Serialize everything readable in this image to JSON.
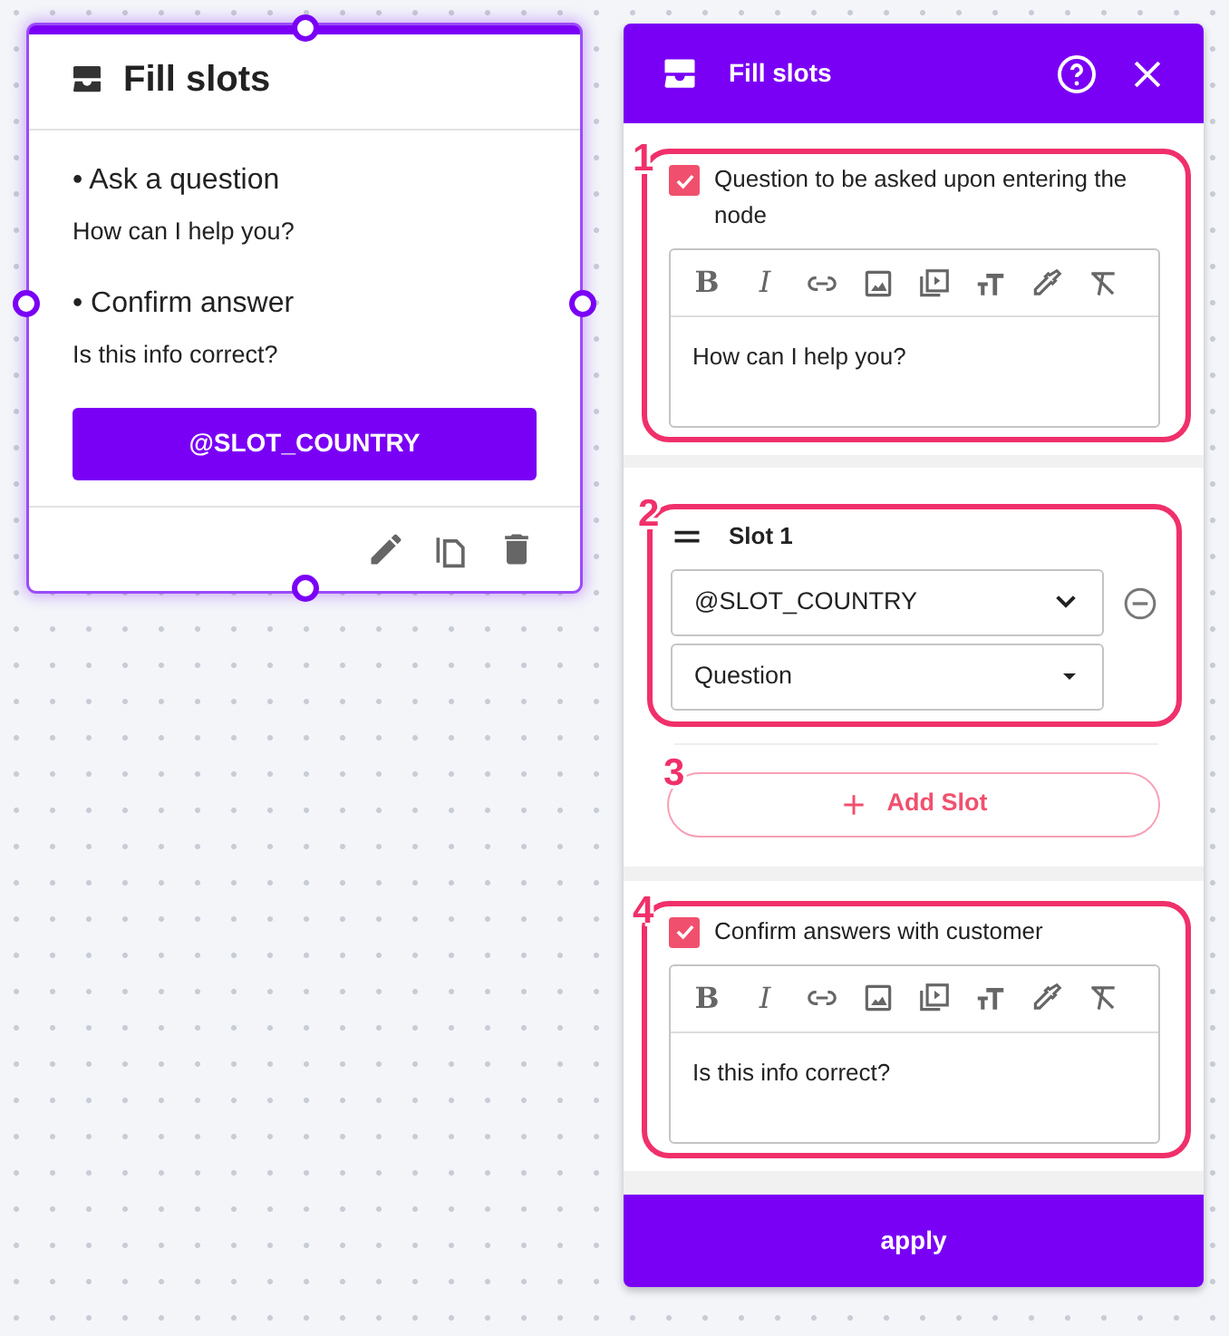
{
  "canvas_node": {
    "title": "Fill slots",
    "selected": true,
    "items": [
      {
        "heading": "• Ask a question",
        "text": "How can I help you?"
      },
      {
        "heading": "• Confirm answer",
        "text": "Is this info correct?"
      }
    ],
    "slot_button": "@SLOT_COUNTRY"
  },
  "panel": {
    "title": "Fill slots",
    "question": {
      "callout": "1",
      "checked": true,
      "label": "Question to be asked upon entering the node",
      "text": "How can I help you?",
      "toolbar": [
        {
          "kind": "bold",
          "label": "B"
        },
        {
          "kind": "italic",
          "label": "I"
        },
        {
          "kind": "link"
        },
        {
          "kind": "image"
        },
        {
          "kind": "video"
        },
        {
          "kind": "text-size"
        },
        {
          "kind": "color"
        },
        {
          "kind": "clear"
        }
      ]
    },
    "slot": {
      "callout": "2",
      "title": "Slot 1",
      "variable": "@SLOT_COUNTRY",
      "type": "Question"
    },
    "add_slot": {
      "callout": "3",
      "label": "Add Slot"
    },
    "confirm": {
      "callout": "4",
      "checked": true,
      "label": "Confirm answers with customer",
      "text": "Is this info correct?",
      "toolbar": [
        {
          "kind": "bold",
          "label": "B"
        },
        {
          "kind": "italic",
          "label": "I"
        },
        {
          "kind": "link"
        },
        {
          "kind": "image"
        },
        {
          "kind": "video"
        },
        {
          "kind": "text-size"
        },
        {
          "kind": "color"
        },
        {
          "kind": "clear"
        }
      ]
    },
    "apply": "apply"
  }
}
